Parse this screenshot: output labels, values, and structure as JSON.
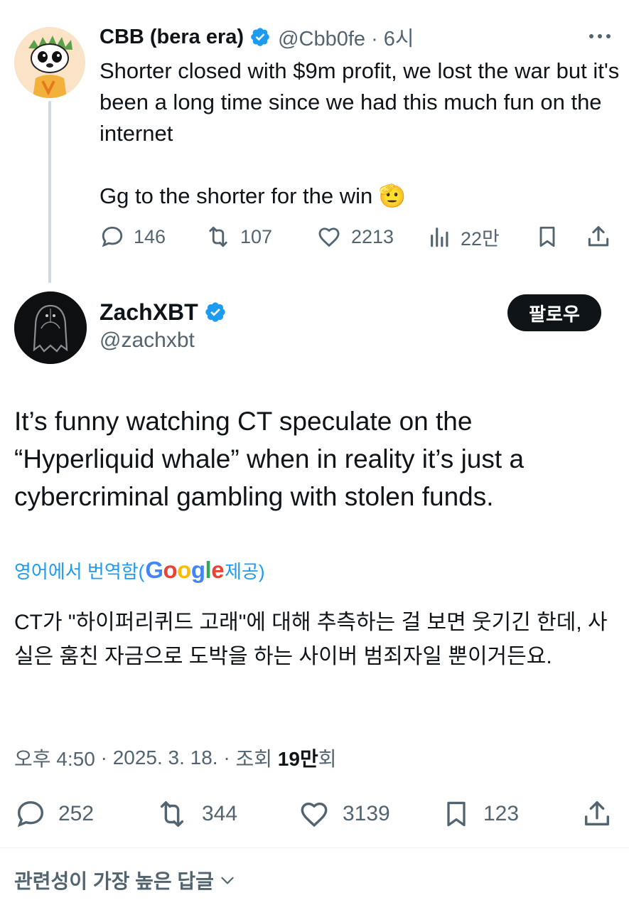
{
  "colors": {
    "accent": "#1d9bf0",
    "text": "#0f1419",
    "muted": "#536471",
    "verified": "#1d9bf0"
  },
  "reply": {
    "avatar_icon": "cartoon-dog-avatar",
    "name": "CBB (bera era)",
    "handle": "@Cbb0fe",
    "time": "6시",
    "text": "Shorter closed with $9m profit, we lost the war but it's been a long time since we had this much fun on the internet\n\nGg to the shorter for the win 🫡",
    "stats": {
      "replies": "146",
      "reposts": "107",
      "likes": "2213",
      "views": "22만"
    }
  },
  "tweet": {
    "avatar_icon": "hooded-ghost-avatar",
    "name": "ZachXBT",
    "handle": "@zachxbt",
    "follow_label": "팔로우",
    "text": "It’s funny watching CT speculate on the “Hyperliquid whale” when in reality it’s just a cybercriminal gambling with stolen funds.",
    "translate_prefix": "영어에서 번역함(",
    "translate_provider": "Google",
    "translate_suffix": " 제공)",
    "translated_text": "CT가 \"하이퍼리퀴드 고래\"에 대해 추측하는 걸 보면 웃기긴 한데, 사실은 훔친 자금으로 도박을 하는 사이버 범죄자일 뿐이거든요.",
    "time": "오후 4:50",
    "date": "2025. 3. 18.",
    "views_label": "조회",
    "views": "19만",
    "views_suffix": "회",
    "stats": {
      "replies": "252",
      "reposts": "344",
      "likes": "3139",
      "bookmarks": "123"
    }
  },
  "sort_label": "관련성이 가장 높은 답글"
}
